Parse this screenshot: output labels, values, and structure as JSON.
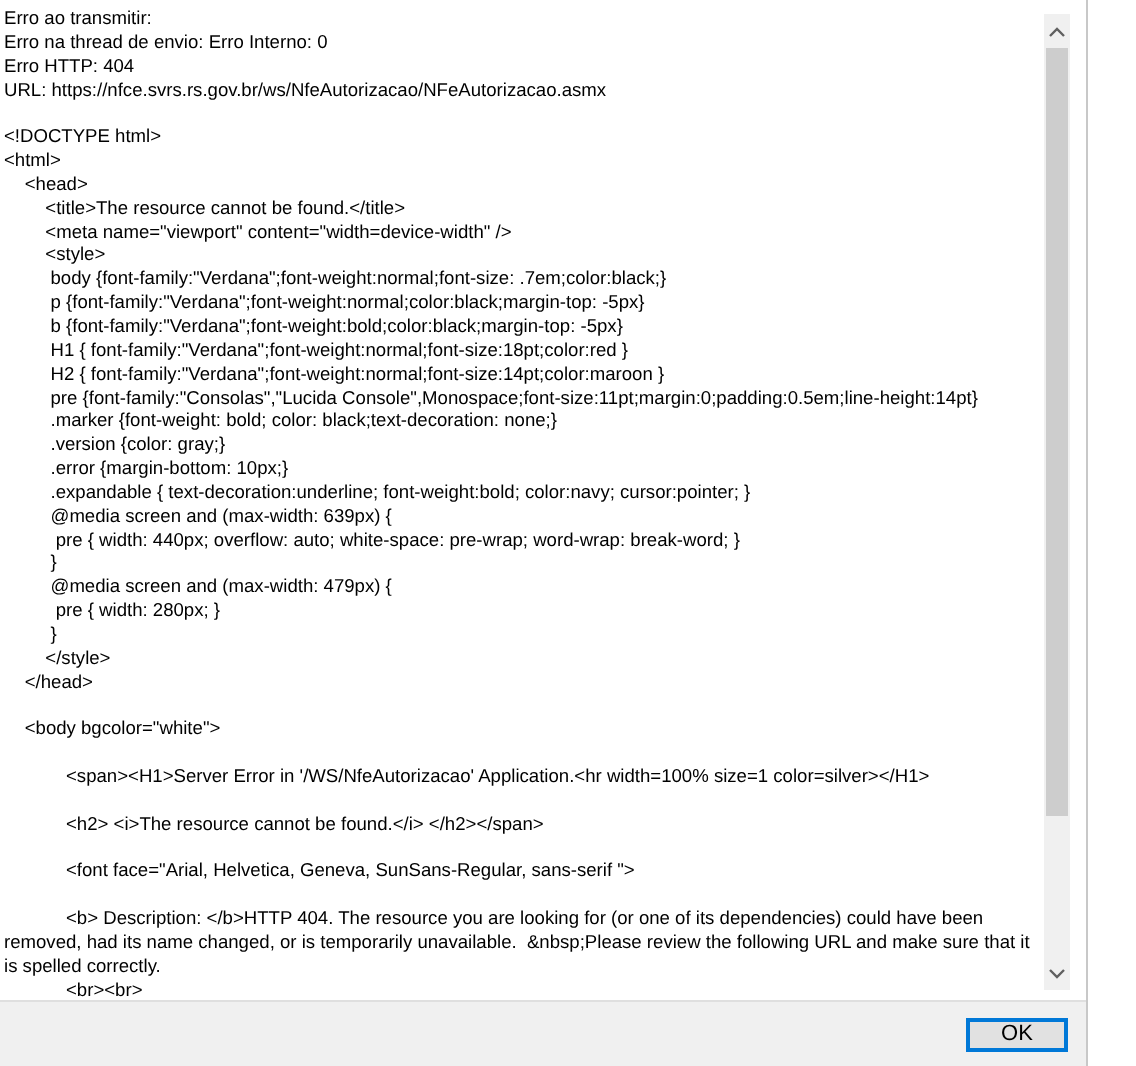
{
  "message": {
    "blocks": [
      [
        "Erro ao transmitir:",
        "Erro na thread de envio: Erro Interno: 0",
        "Erro HTTP: 404",
        "URL: https://nfce.svrs.rs.gov.br/ws/NfeAutorizacao/NFeAutorizacao.asmx"
      ],
      [
        "<!DOCTYPE html>",
        "<html>",
        "    <head>",
        "        <title>The resource cannot be found.</title>",
        "        <meta name=\"viewport\" content=\"width=device-width\" />",
        "        <style>",
        "         body {font-family:\"Verdana\";font-weight:normal;font-size: .7em;color:black;}",
        "         p {font-family:\"Verdana\";font-weight:normal;color:black;margin-top: -5px}",
        "         b {font-family:\"Verdana\";font-weight:bold;color:black;margin-top: -5px}",
        "         H1 { font-family:\"Verdana\";font-weight:normal;font-size:18pt;color:red }",
        "         H2 { font-family:\"Verdana\";font-weight:normal;font-size:14pt;color:maroon }",
        "         pre {font-family:\"Consolas\",\"Lucida Console\",Monospace;font-size:11pt;margin:0;padding:0.5em;line-height:14pt}",
        "         .marker {font-weight: bold; color: black;text-decoration: none;}",
        "         .version {color: gray;}",
        "         .error {margin-bottom: 10px;}",
        "         .expandable { text-decoration:underline; font-weight:bold; color:navy; cursor:pointer; }",
        "         @media screen and (max-width: 639px) {",
        "          pre { width: 440px; overflow: auto; white-space: pre-wrap; word-wrap: break-word; }",
        "         }",
        "         @media screen and (max-width: 479px) {",
        "          pre { width: 280px; }",
        "         }",
        "        </style>",
        "    </head>"
      ],
      [
        "    <body bgcolor=\"white\">"
      ],
      [
        "            <span><H1>Server Error in '/WS/NfeAutorizacao' Application.<hr width=100% size=1 color=silver></H1>"
      ],
      [
        "            <h2> <i>The resource cannot be found.</i> </h2></span>"
      ],
      [
        "            <font face=\"Arial, Helvetica, Geneva, SunSans-Regular, sans-serif \">"
      ],
      [
        "            <b> Description: </b>HTTP 404. The resource you are looking for (or one of its dependencies) could have been removed, had its name changed, or is temporarily unavailable.  &nbsp;Please review the following URL and make sure that it is spelled correctly.",
        "            <br><br>"
      ]
    ]
  },
  "buttons": [
    {
      "label": "OK",
      "selected": true
    }
  ]
}
